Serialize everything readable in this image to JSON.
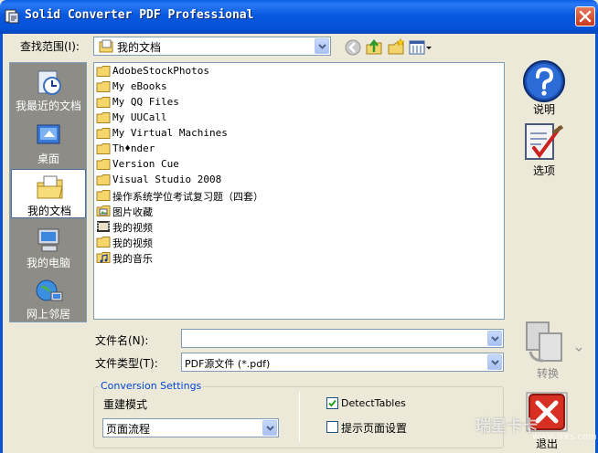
{
  "window": {
    "title": "Solid Converter PDF Professional"
  },
  "lookin": {
    "label": "查找范围(I):",
    "value": "我的文档"
  },
  "places": [
    {
      "label": "我最近的文档",
      "icon": "recent-documents-icon"
    },
    {
      "label": "桌面",
      "icon": "desktop-icon"
    },
    {
      "label": "我的文档",
      "icon": "my-documents-icon"
    },
    {
      "label": "我的电脑",
      "icon": "my-computer-icon"
    },
    {
      "label": "网上邻居",
      "icon": "network-places-icon"
    }
  ],
  "files": [
    {
      "name": "AdobeStockPhotos",
      "icon": "folder-icon"
    },
    {
      "name": "My eBooks",
      "icon": "folder-icon"
    },
    {
      "name": "My QQ Files",
      "icon": "folder-icon"
    },
    {
      "name": "My UUCall",
      "icon": "folder-icon"
    },
    {
      "name": "My Virtual Machines",
      "icon": "folder-icon"
    },
    {
      "name": "Th♦nder",
      "icon": "folder-icon"
    },
    {
      "name": "Version Cue",
      "icon": "folder-icon"
    },
    {
      "name": "Visual Studio 2008",
      "icon": "folder-icon"
    },
    {
      "name": "操作系统学位考试复习题（四套）",
      "icon": "folder-icon"
    },
    {
      "name": "图片收藏",
      "icon": "pictures-folder-icon"
    },
    {
      "name": "我的视频",
      "icon": "video-folder-icon"
    },
    {
      "name": "我的视频",
      "icon": "folder-icon"
    },
    {
      "name": "我的音乐",
      "icon": "music-folder-icon"
    }
  ],
  "filename": {
    "label": "文件名(N):",
    "value": ""
  },
  "filetype": {
    "label": "文件类型(T):",
    "value": "PDF源文件 (*.pdf)"
  },
  "side": {
    "help_label": "说明",
    "options_label": "选项",
    "convert_label": "转换",
    "exit_label": "退出"
  },
  "conversion": {
    "group_title": "Conversion Settings",
    "mode_label": "重建模式",
    "mode_value": "页面流程",
    "detect_tables_label": "DetectTables",
    "detect_tables_checked": true,
    "prompt_settings_label": "提示页面设置",
    "prompt_settings_checked": false
  },
  "watermark": {
    "text": "瑞星卡卡",
    "url": "www.lkks.com"
  }
}
